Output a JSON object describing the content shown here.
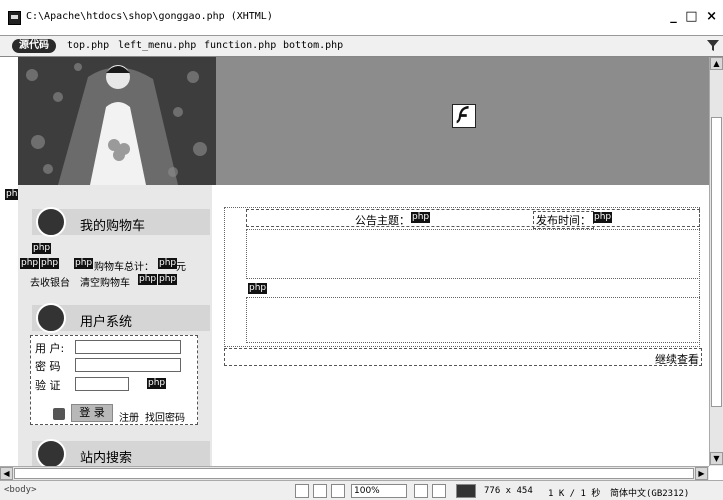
{
  "window": {
    "title": "C:\\Apache\\htdocs\\shop\\gonggao.php (XHTML)",
    "controls": "_ □ ×"
  },
  "filesbar": {
    "source_label": "源代码",
    "files": [
      "top.php",
      "left_menu.php",
      "function.php",
      "bottom.php"
    ]
  },
  "canvas": {
    "php_tag": "php",
    "sidebar": {
      "cart_title": "我的购物车",
      "cart_total_label": "购物车总计：",
      "currency": "元",
      "checkout_link": "去收银台",
      "clear_cart_link": "清空购物车",
      "user_system_title": "用户系统",
      "username_label": "用 户:",
      "password_label": "密 码",
      "captcha_label": "验 证",
      "login_button": "登 录",
      "register_link": "注册",
      "forgot_password_link": "找回密码",
      "site_search_title": "站内搜索"
    },
    "main": {
      "topic_label": "公告主题：",
      "publish_time_label": "发布时间：",
      "more_link": "继续查看"
    }
  },
  "statusbar": {
    "tag_path": "<body>",
    "zoom": "100%",
    "window_size": "776 x 454",
    "file_info": "1 K / 1 秒",
    "encoding": "简体中文(GB2312)"
  },
  "colors": {
    "banner_gray": "#8c8c8c",
    "sidebar_bg": "#e8e8e8",
    "tag_bg": "#111111"
  }
}
